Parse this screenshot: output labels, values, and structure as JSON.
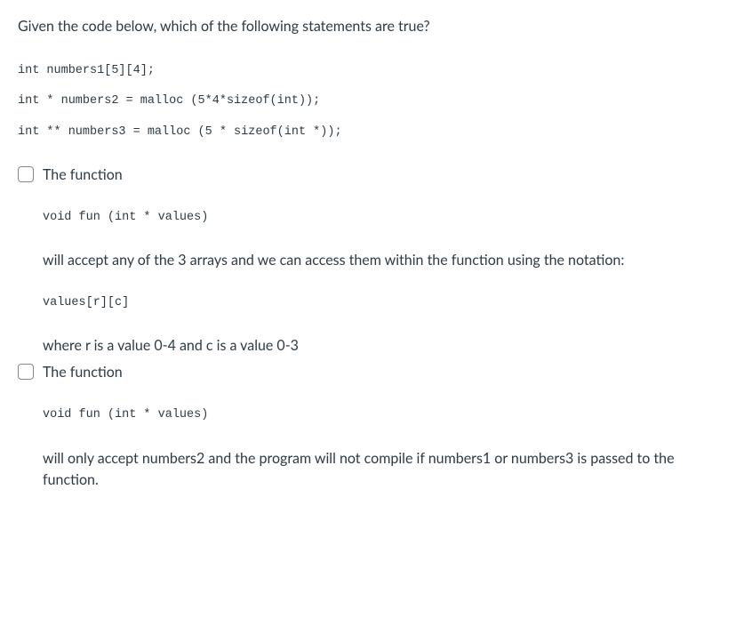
{
  "question": {
    "prompt": "Given the code below, which of the following statements are true?",
    "code_lines": [
      "int numbers1[5][4];",
      "int * numbers2 = malloc (5*4*sizeof(int));",
      "int ** numbers3 = malloc (5 * sizeof(int *));"
    ]
  },
  "options": [
    {
      "intro": "The function",
      "code1": "void fun (int * values)",
      "body1": "will accept any of the 3 arrays and we can access them within the function using the notation:",
      "code2": "values[r][c]",
      "body2": "where r is a value 0-4 and c is a value 0-3"
    },
    {
      "intro": "The function",
      "code1": "void fun (int * values)",
      "body1": "will only accept numbers2 and the program will not compile if numbers1 or numbers3 is passed to the function."
    }
  ]
}
